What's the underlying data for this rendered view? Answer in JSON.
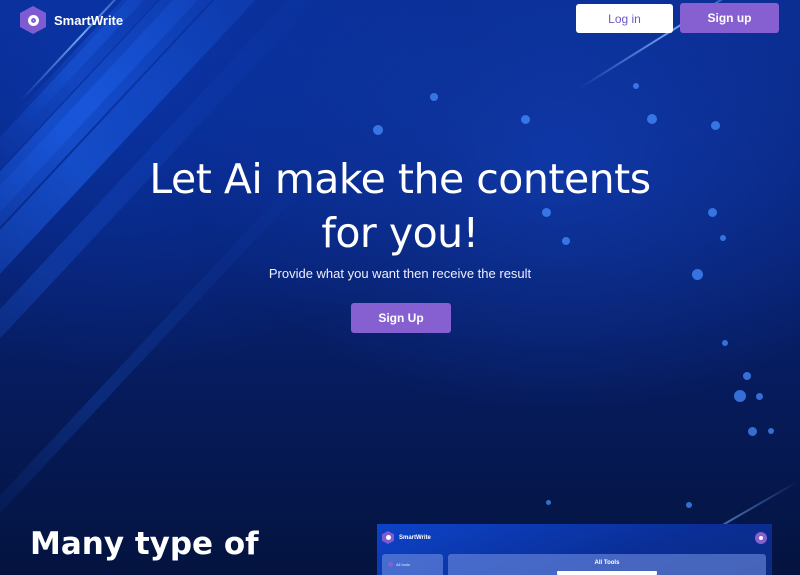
{
  "header": {
    "brand": "SmartWrite",
    "login_label": "Log in",
    "signup_label": "Sign up"
  },
  "hero": {
    "title_line1": "Let Ai make the contents",
    "title_line2": "for you!",
    "subtitle": "Provide what you want then receive the result",
    "cta_label": "Sign Up"
  },
  "section": {
    "title": "Many type of"
  },
  "preview": {
    "brand": "SmartWrite",
    "sidebar_item": "All tools",
    "main_title": "All Tools"
  },
  "colors": {
    "accent": "#8660d0",
    "background": "#082377",
    "login_text": "#7057c6"
  },
  "icons": [
    "hexagon-logo-icon",
    "avatar-icon"
  ]
}
